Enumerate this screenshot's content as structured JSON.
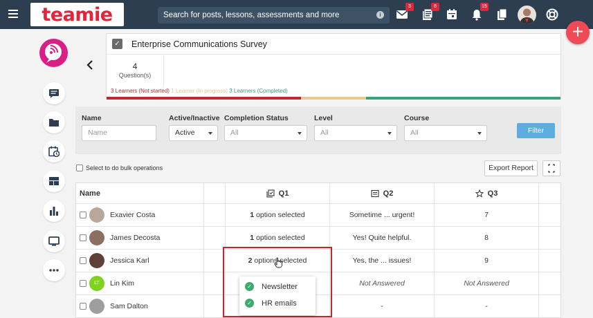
{
  "app": {
    "logo_text": "teamie"
  },
  "topbar": {
    "search_placeholder": "Search for posts, lessons, assessments and more",
    "messages_count": "3",
    "lessons_count": "8",
    "notifications_count": "15",
    "fab_label": "+"
  },
  "survey": {
    "title": "Enterprise Communications Survey",
    "question_count": "4",
    "question_label": "Question(s)",
    "not_started": "3 Learners (Not started)",
    "in_progress": "1 Learner (In progress)",
    "completed": "3 Learners (Completed)",
    "progress": {
      "not_started": 3,
      "in_progress": 1,
      "completed": 3
    },
    "colors": {
      "not_started": "#c0282f",
      "in_progress": "#e8c88e",
      "completed": "#3aa27b"
    }
  },
  "filters": {
    "name_label": "Name",
    "name_placeholder": "Name",
    "active_label": "Active/Inactive",
    "active_value": "Active",
    "completion_label": "Completion Status",
    "completion_value": "All",
    "level_label": "Level",
    "level_value": "All",
    "course_label": "Course",
    "course_value": "All",
    "filter_button": "Filter"
  },
  "bulk_label": "Select to do bulk operations",
  "export_label": "Export Report",
  "table": {
    "headers": {
      "name": "Name",
      "q1": "Q1",
      "q2": "Q2",
      "q3": "Q3"
    },
    "rows": [
      {
        "name": "Exavier Costa",
        "q1_count": "1",
        "q1_text": " option selected",
        "q2": "Sometime ... urgent!",
        "q3": "7"
      },
      {
        "name": "James Decosta",
        "q1_count": "1",
        "q1_text": " option selected",
        "q2": "Yes! Quite helpful.",
        "q3": "8"
      },
      {
        "name": "Jessica Karl",
        "q1_count": "2",
        "q1_text": " options selected",
        "q2": "Yes, the ... issues!",
        "q3": "9"
      },
      {
        "name": "Lin Kim",
        "initials": "LT",
        "q1_count": "",
        "q1_text": "",
        "q2": "Not Answered",
        "q3": "Not Answered"
      },
      {
        "name": "Sam Dalton",
        "q1_count": "",
        "q1_text": "",
        "q2": "-",
        "q3": "-"
      }
    ]
  },
  "popover": {
    "options": [
      "Newsletter",
      "HR emails"
    ]
  }
}
